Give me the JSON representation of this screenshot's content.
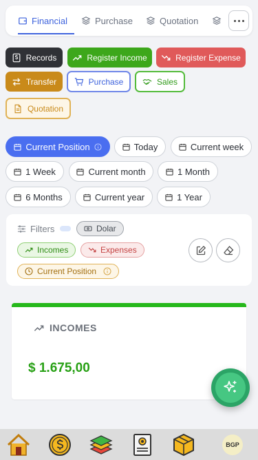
{
  "tabs": [
    {
      "label": "Financial",
      "active": true
    },
    {
      "label": "Purchase",
      "active": false
    },
    {
      "label": "Quotation",
      "active": false
    }
  ],
  "actions": {
    "records": "Records",
    "register_income": "Register Income",
    "register_expense": "Register Expense",
    "transfer": "Transfer",
    "purchase": "Purchase",
    "sales": "Sales",
    "quotation": "Quotation"
  },
  "periods": {
    "current_position": "Current Position",
    "today": "Today",
    "current_week": "Current week",
    "one_week": "1 Week",
    "current_month": "Current month",
    "one_month": "1 Month",
    "six_months": "6 Months",
    "current_year": "Current year",
    "one_year": "1 Year"
  },
  "filters": {
    "title": "Filters",
    "currency": "Dolar",
    "incomes": "Incomes",
    "expenses": "Expenses",
    "period": "Current Position"
  },
  "income_card": {
    "title": "INCOMES",
    "value": "$ 1.675,00"
  },
  "bottom_nav": {
    "profile_initials": "BGP"
  },
  "colors": {
    "primary": "#3e63dd",
    "income": "#3da71b",
    "expense": "#e05a5a",
    "transfer": "#c98a1a"
  }
}
